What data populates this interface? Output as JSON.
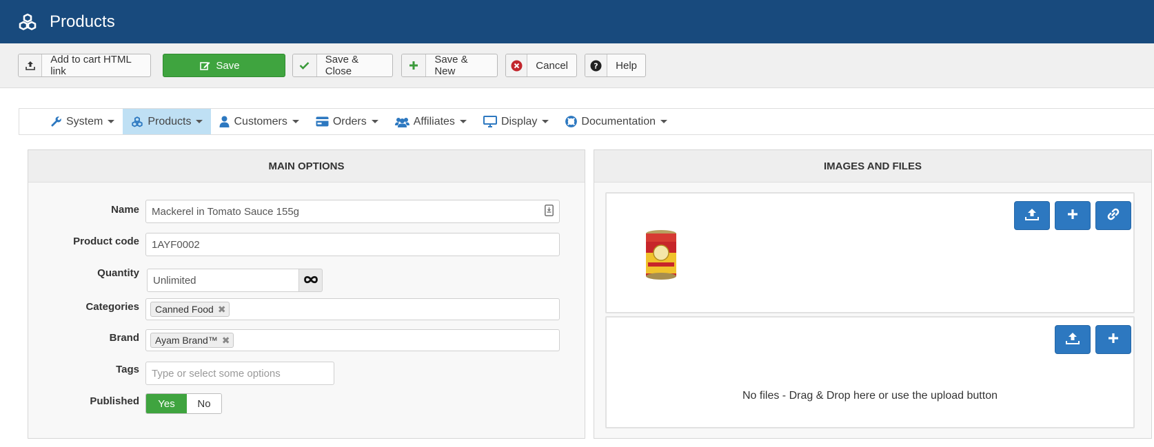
{
  "header": {
    "title": "Products"
  },
  "toolbar": {
    "add_to_cart": "Add to cart HTML link",
    "save": "Save",
    "save_close": "Save & Close",
    "save_new": "Save & New",
    "cancel": "Cancel",
    "help": "Help"
  },
  "nav": {
    "items": [
      {
        "label": "System",
        "icon": "wrench-icon"
      },
      {
        "label": "Products",
        "icon": "cubes-icon",
        "active": true
      },
      {
        "label": "Customers",
        "icon": "user-icon"
      },
      {
        "label": "Orders",
        "icon": "credit-card-icon"
      },
      {
        "label": "Affiliates",
        "icon": "users-icon"
      },
      {
        "label": "Display",
        "icon": "desktop-icon"
      },
      {
        "label": "Documentation",
        "icon": "life-ring-icon"
      }
    ]
  },
  "main_options": {
    "heading": "MAIN OPTIONS",
    "name_label": "Name",
    "name_value": "Mackerel in Tomato Sauce 155g",
    "code_label": "Product code",
    "code_value": "1AYF0002",
    "quantity_label": "Quantity",
    "quantity_value": "Unlimited",
    "categories_label": "Categories",
    "category_tag": "Canned Food",
    "brand_label": "Brand",
    "brand_tag": "Ayam Brand™",
    "tags_label": "Tags",
    "tags_placeholder": "Type or select some options",
    "published_label": "Published",
    "published_yes": "Yes",
    "published_no": "No"
  },
  "images_files": {
    "heading": "IMAGES AND FILES",
    "no_files_text": "No files - Drag & Drop here or use the upload button"
  },
  "colors": {
    "header_bg": "#184a7d",
    "save_green": "#3fa43f",
    "action_blue": "#2d78c0",
    "nav_active": "#bfe0f4"
  }
}
